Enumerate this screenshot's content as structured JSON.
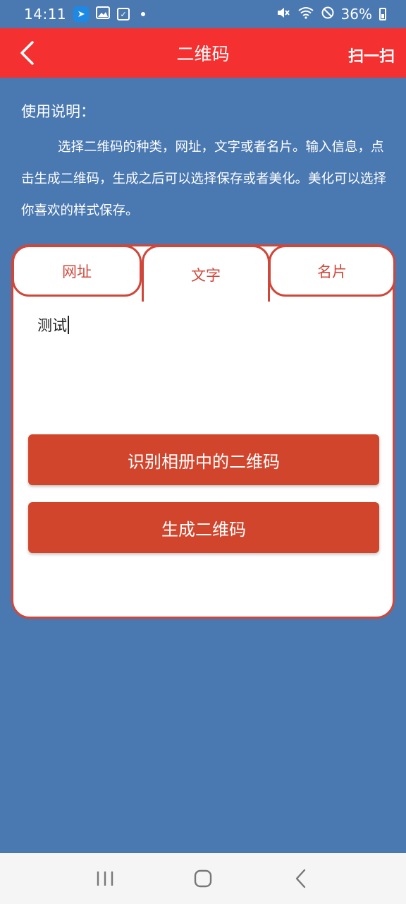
{
  "status_bar": {
    "time": "14:11",
    "battery": "36%",
    "icons": [
      "location-app-icon",
      "gallery-icon",
      "checkbox-icon",
      "notification-dot-icon",
      "mute-icon",
      "wifi-icon",
      "do-not-disturb-icon",
      "battery-icon"
    ]
  },
  "header": {
    "title": "二维码",
    "scan_label": "扫一扫",
    "back_icon": "back-chevron-icon"
  },
  "instructions": {
    "title": "使用说明：",
    "body": "选择二维码的种类，网址，文字或者名片。输入信息，点击生成二维码，生成之后可以选择保存或者美化。美化可以选择你喜欢的样式保存。"
  },
  "tabs": [
    {
      "label": "网址",
      "selected": false
    },
    {
      "label": "文字",
      "selected": true
    },
    {
      "label": "名片",
      "selected": false
    }
  ],
  "input": {
    "value": "测试"
  },
  "buttons": {
    "scan_album": "识别相册中的二维码",
    "generate": "生成二维码"
  },
  "nav_bar": {
    "icons": [
      "recent-apps-icon",
      "home-icon",
      "back-icon"
    ]
  },
  "colors": {
    "background": "#4a78b1",
    "header": "#f43030",
    "accent": "#d0473a",
    "button": "#d2452d",
    "nav_bar": "#f5f5f5"
  }
}
